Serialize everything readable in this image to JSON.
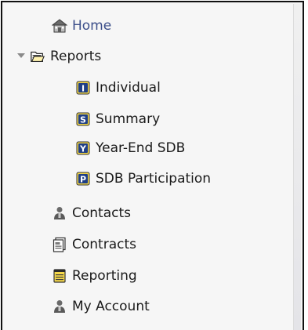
{
  "nav": {
    "home": {
      "label": "Home",
      "icon": "home-icon"
    },
    "reports": {
      "label": "Reports",
      "icon": "folder-open-icon",
      "expanded": true,
      "children": [
        {
          "label": "Individual",
          "icon": "report-i-icon",
          "letter": "I"
        },
        {
          "label": "Summary",
          "icon": "report-s-icon",
          "letter": "S"
        },
        {
          "label": "Year-End SDB",
          "icon": "report-y-icon",
          "letter": "Y"
        },
        {
          "label": "SDB Participation",
          "icon": "report-p-icon",
          "letter": "P"
        }
      ]
    },
    "contacts": {
      "label": "Contacts",
      "icon": "person-icon"
    },
    "contracts": {
      "label": "Contracts",
      "icon": "document-icon"
    },
    "reporting": {
      "label": "Reporting",
      "icon": "notepad-icon"
    },
    "my_account": {
      "label": "My Account",
      "icon": "person-icon"
    }
  },
  "colors": {
    "active_link": "#3c4f8a",
    "text": "#1a1a1a",
    "panel_bg": "#f6f6f6",
    "badge_blue": "#1f3f86",
    "notepad_yellow": "#f5d84a"
  }
}
